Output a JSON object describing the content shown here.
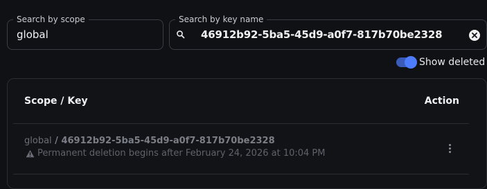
{
  "filters": {
    "scope_label": "Search by scope",
    "scope_value": "global",
    "key_label": "Search by key name",
    "key_value": "46912b92-5ba5-45d9-a0f7-817b70be2328"
  },
  "toggle": {
    "label": "Show deleted",
    "on": true
  },
  "table": {
    "columns": [
      "Scope / Key",
      "Action"
    ],
    "rows": [
      {
        "scope": "global",
        "separator": " / ",
        "key": "46912b92-5ba5-45d9-a0f7-817b70be2328",
        "note": "Permanent deletion begins after February 24, 2026 at 10:04 PM"
      }
    ]
  },
  "icons": {
    "search": "search-icon",
    "clear": "clear-icon",
    "warning": "warning-icon",
    "more": "more-vertical-icon"
  },
  "colors": {
    "accent": "#4d7cff",
    "background": "#101114"
  }
}
